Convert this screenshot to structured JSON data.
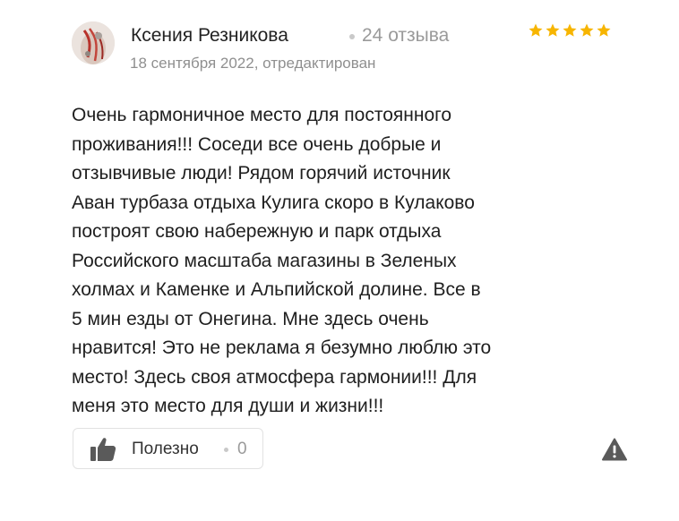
{
  "review": {
    "author_name": "Ксения Резникова",
    "review_count": "24 отзыва",
    "rating": 5,
    "date": "18 сентября 2022, отредактирован",
    "text": "Очень гармоничное место для постоянного\nпроживания!!! Соседи все очень добрые и\nотзывчивые люди! Рядом горячий источник\nАван турбаза отдыха Кулига скоро в Кулаково\nпостроят свою набережную и парк отдыха\nРоссийского масштаба магазины в Зеленых\nхолмах и Каменке и Альпийской долине. Все в\n5 мин езды от Онегина. Мне здесь очень\nнравится! Это не реклама я безумно люблю это\nместо! Здесь своя атмосфера гармонии!!! Для\nменя это место для души и жизни!!!"
  },
  "actions": {
    "useful_label": "Полезно",
    "useful_count": "0"
  },
  "colors": {
    "star": "#f7b500",
    "icon": "#5a5a5a",
    "muted_text": "#9a9a9a"
  },
  "icons": {
    "rating": "star-icon",
    "useful": "thumbs-up-icon",
    "report": "warning-triangle-icon"
  }
}
